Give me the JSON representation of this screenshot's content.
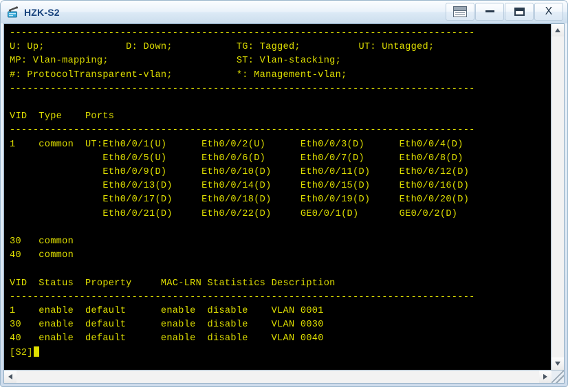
{
  "window": {
    "title": "HZK-S2",
    "icon": "switch-icon",
    "buttons": {
      "menu_label": "",
      "minimize_label": "",
      "maximize_label": "",
      "close_label": "X"
    }
  },
  "terminal": {
    "text_color": "#dfdf00",
    "background_color": "#000000",
    "prompt": "[S2]",
    "legend": {
      "divider": "--------------------------------------------------------------------------------",
      "line1": "U: Up;              D: Down;           TG: Tagged;          UT: Untagged;",
      "line2": "MP: Vlan-mapping;                      ST: Vlan-stacking;",
      "line3": "#: ProtocolTransparent-vlan;           *: Management-vlan;"
    },
    "ports_table": {
      "header": "VID  Type    Ports",
      "rows": [
        "1    common  UT:Eth0/0/1(U)      Eth0/0/2(U)      Eth0/0/3(D)      Eth0/0/4(D)",
        "                Eth0/0/5(U)      Eth0/0/6(D)      Eth0/0/7(D)      Eth0/0/8(D)",
        "                Eth0/0/9(D)      Eth0/0/10(D)     Eth0/0/11(D)     Eth0/0/12(D)",
        "                Eth0/0/13(D)     Eth0/0/14(D)     Eth0/0/15(D)     Eth0/0/16(D)",
        "                Eth0/0/17(D)     Eth0/0/18(D)     Eth0/0/19(D)     Eth0/0/20(D)",
        "                Eth0/0/21(D)     Eth0/0/22(D)     GE0/0/1(D)       GE0/0/2(D)",
        "",
        "30   common",
        "40   common"
      ]
    },
    "status_table": {
      "header": "VID  Status  Property     MAC-LRN Statistics Description",
      "rows": [
        "1    enable  default      enable  disable    VLAN 0001",
        "30   enable  default      enable  disable    VLAN 0030",
        "40   enable  default      enable  disable    VLAN 0040"
      ]
    },
    "full_text": "--------------------------------------------------------------------------------\nU: Up;              D: Down;           TG: Tagged;          UT: Untagged;\nMP: Vlan-mapping;                      ST: Vlan-stacking;\n#: ProtocolTransparent-vlan;           *: Management-vlan;\n--------------------------------------------------------------------------------\n\nVID  Type    Ports\n--------------------------------------------------------------------------------\n1    common  UT:Eth0/0/1(U)      Eth0/0/2(U)      Eth0/0/3(D)      Eth0/0/4(D)\n                Eth0/0/5(U)      Eth0/0/6(D)      Eth0/0/7(D)      Eth0/0/8(D)\n                Eth0/0/9(D)      Eth0/0/10(D)     Eth0/0/11(D)     Eth0/0/12(D)\n                Eth0/0/13(D)     Eth0/0/14(D)     Eth0/0/15(D)     Eth0/0/16(D)\n                Eth0/0/17(D)     Eth0/0/18(D)     Eth0/0/19(D)     Eth0/0/20(D)\n                Eth0/0/21(D)     Eth0/0/22(D)     GE0/0/1(D)       GE0/0/2(D)\n\n30   common\n40   common\n\nVID  Status  Property     MAC-LRN Statistics Description\n--------------------------------------------------------------------------------\n1    enable  default      enable  disable    VLAN 0001\n30   enable  default      enable  disable    VLAN 0030\n40   enable  default      enable  disable    VLAN 0040\n[S2]"
  },
  "scrollbars": {
    "vertical": {
      "up_icon": "chevron-up-icon",
      "down_icon": "chevron-down-icon"
    },
    "horizontal": {
      "left_icon": "chevron-left-icon",
      "right_icon": "chevron-right-icon"
    },
    "resize_grip": "resize-grip-icon"
  }
}
